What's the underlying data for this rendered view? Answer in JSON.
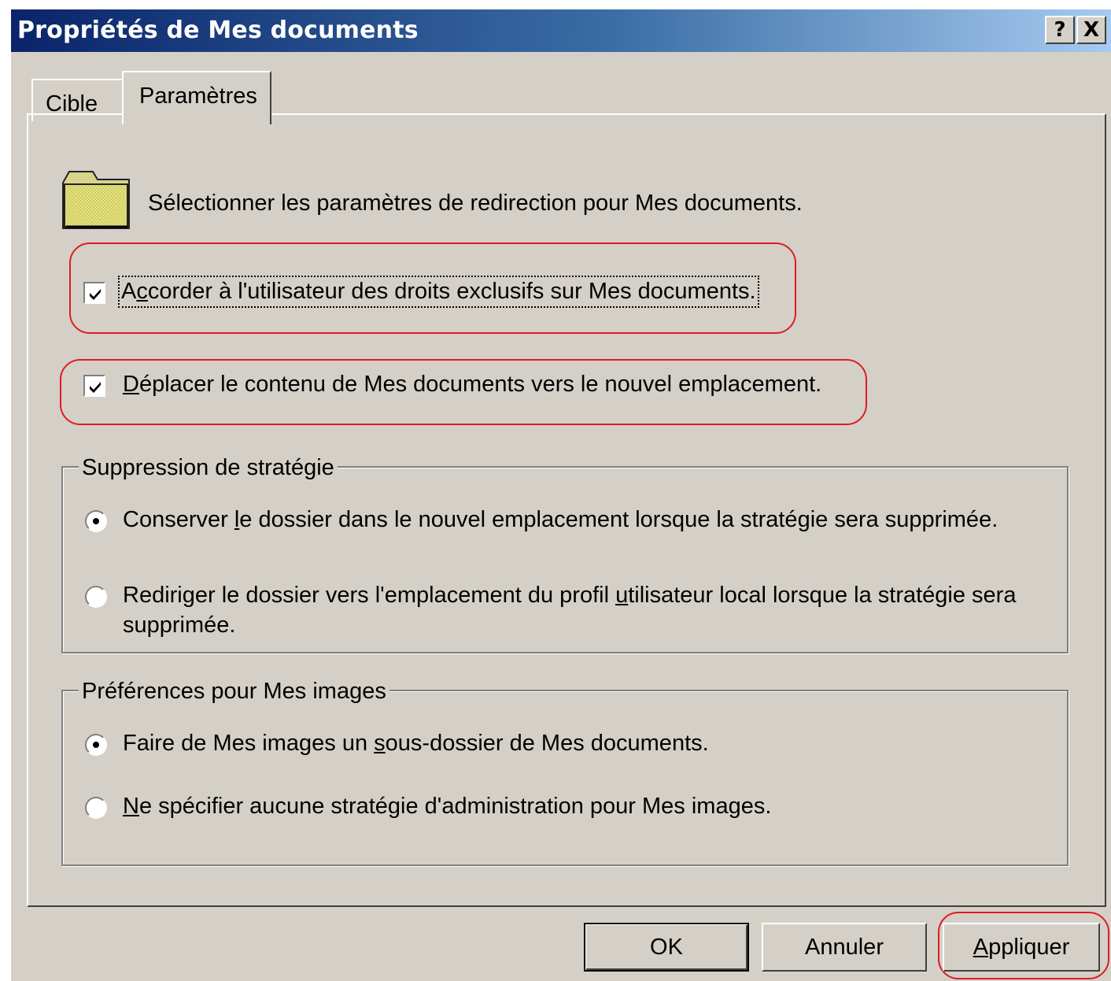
{
  "window": {
    "title": "Propriétés de Mes documents",
    "help_label": "?",
    "close_label": "X"
  },
  "tabs": [
    {
      "label": "Cible",
      "active": false
    },
    {
      "label": "Paramètres",
      "active": true
    }
  ],
  "header": {
    "icon": "folder-icon",
    "text": "Sélectionner les paramètres de redirection pour Mes documents."
  },
  "options": {
    "exclusive_rights": {
      "pre": "A",
      "key": "c",
      "post": "corder à l'utilisateur des droits exclusifs sur Mes documents.",
      "checked": true
    },
    "move_contents": {
      "pre": "",
      "key": "D",
      "post": "éplacer le contenu de Mes documents vers le nouvel emplacement.",
      "checked": true
    }
  },
  "policy_removal": {
    "legend": "Suppression de stratégie",
    "options": [
      {
        "pre": "Conserver ",
        "key": "l",
        "post": "e dossier dans le nouvel emplacement lorsque la stratégie sera supprimée.",
        "selected": true
      },
      {
        "pre": "Rediriger le dossier vers l'emplacement du profil ",
        "key": "u",
        "post": "tilisateur local lorsque la stratégie sera",
        "line2": "supprimée.",
        "selected": false
      }
    ]
  },
  "my_pictures": {
    "legend": "Préférences pour Mes images",
    "options": [
      {
        "pre": "Faire de Mes images un ",
        "key": "s",
        "post": "ous-dossier de Mes documents.",
        "selected": true
      },
      {
        "pre": "",
        "key": "N",
        "post": "e spécifier aucune stratégie d'administration pour Mes images.",
        "selected": false
      }
    ]
  },
  "buttons": {
    "ok": "OK",
    "cancel": "Annuler",
    "apply_key": "A",
    "apply_rest": "ppliquer"
  },
  "colors": {
    "dialog_face": "#d4d0c8",
    "titlebar_start": "#0a246a",
    "titlebar_end": "#a6caf0",
    "highlight": "#e01b24",
    "folder": "#e4e07c"
  }
}
